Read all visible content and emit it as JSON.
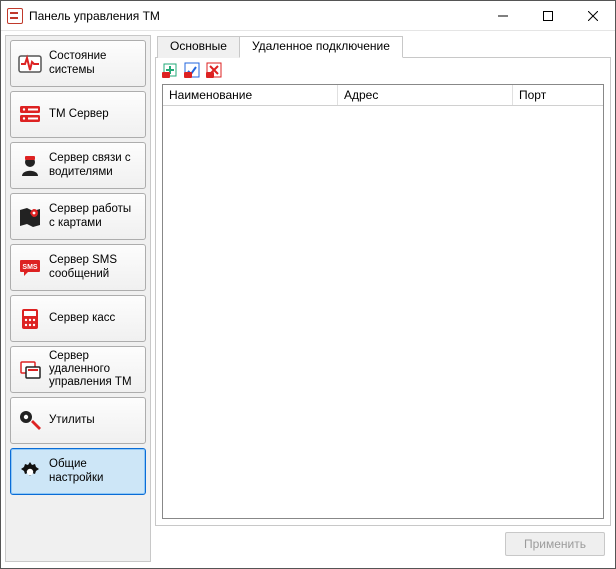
{
  "window": {
    "title": "Панель управления ТМ"
  },
  "sidebar": {
    "items": [
      {
        "label": "Состояние системы"
      },
      {
        "label": "ТМ Сервер"
      },
      {
        "label": "Сервер связи с водителями"
      },
      {
        "label": "Сервер работы с картами"
      },
      {
        "label": "Сервер SMS сообщений"
      },
      {
        "label": "Сервер касс"
      },
      {
        "label": "Сервер удаленного управления ТМ"
      },
      {
        "label": "Утилиты"
      },
      {
        "label": "Общие настройки"
      }
    ],
    "active_index": 8
  },
  "tabs": {
    "items": [
      {
        "label": "Основные"
      },
      {
        "label": "Удаленное подключение"
      }
    ],
    "active_index": 1
  },
  "toolbar": {
    "add_tip": "Добавить",
    "edit_tip": "Изменить",
    "delete_tip": "Удалить"
  },
  "list": {
    "columns": [
      "Наименование",
      "Адрес",
      "Порт"
    ],
    "rows": []
  },
  "footer": {
    "apply_label": "Применить",
    "apply_enabled": false
  }
}
